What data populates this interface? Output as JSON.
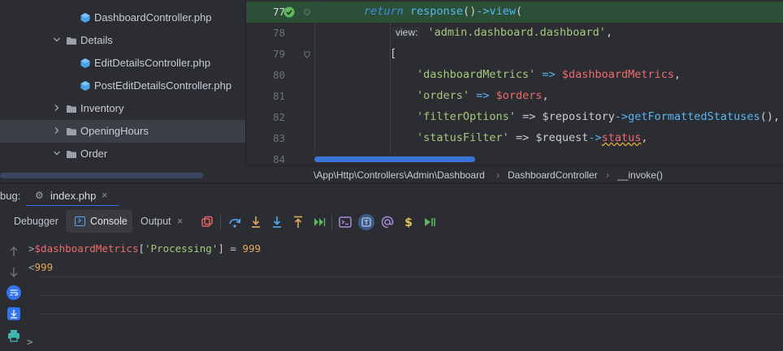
{
  "project_tree": {
    "items": [
      {
        "label": "DashboardController.php",
        "kind": "php-class-file"
      },
      {
        "label": "Details",
        "kind": "folder",
        "expanded": true
      },
      {
        "label": "EditDetailsController.php",
        "kind": "php-class-file"
      },
      {
        "label": "PostEditDetailsController.php",
        "kind": "php-class-file"
      },
      {
        "label": "Inventory",
        "kind": "folder",
        "expanded": false
      },
      {
        "label": "OpeningHours",
        "kind": "folder",
        "expanded": false,
        "selected": true
      },
      {
        "label": "Order",
        "kind": "folder",
        "expanded": true
      }
    ]
  },
  "editor": {
    "lines": [
      {
        "number": "77",
        "current": true
      },
      {
        "number": "78"
      },
      {
        "number": "79"
      },
      {
        "number": "80"
      },
      {
        "number": "81"
      },
      {
        "number": "82"
      },
      {
        "number": "83"
      },
      {
        "number": "84"
      }
    ],
    "code": {
      "l77": {
        "kw": "return",
        "fn1": "response",
        "paren1": "()",
        "arrow": "->",
        "fn2": "view",
        "paren2": "("
      },
      "l78": {
        "hint": "view:",
        "str": "'admin.dashboard.dashboard'",
        "punct": ","
      },
      "l79": {
        "bracket": "["
      },
      "l80": {
        "key": "'dashboardMetrics'",
        "arrow": "=>",
        "var": "$dashboardMetrics",
        "punct": ","
      },
      "l81": {
        "key": "'orders'",
        "arrow": "=>",
        "var": "$orders",
        "punct": ","
      },
      "l82": {
        "key": "'filterOptions'",
        "arrow": "=>",
        "obj": "$repository",
        "op": "->",
        "method": "getFormattedStatuses",
        "tail": "(),"
      },
      "l83": {
        "key": "'statusFilter'",
        "arrow": "=>",
        "obj": "$request",
        "op": "->",
        "prop": "status",
        "punct": ","
      }
    },
    "breadcrumb": [
      "\\App\\Http\\Controllers\\Admin\\Dashboard",
      "DashboardController",
      "__invoke()"
    ]
  },
  "debug": {
    "label": "bug:",
    "file_tab": "index.php",
    "close_glyph": "×",
    "tabs": {
      "debugger": "Debugger",
      "console": "Console",
      "output": "Output"
    },
    "console": {
      "input": {
        "prompt": ">",
        "var": "$dashboardMetrics",
        "open": "[",
        "key": "'Processing'",
        "close": "]",
        "assign": " = ",
        "value": "999"
      },
      "result": {
        "prompt": "<",
        "value": "999"
      },
      "empty_prompt": ">"
    }
  },
  "colors": {
    "accent": "#3574f0",
    "exec_line": "#2c5037",
    "string": "#a6c97a",
    "variable": "#ef6b6b",
    "number": "#e0a95b"
  }
}
